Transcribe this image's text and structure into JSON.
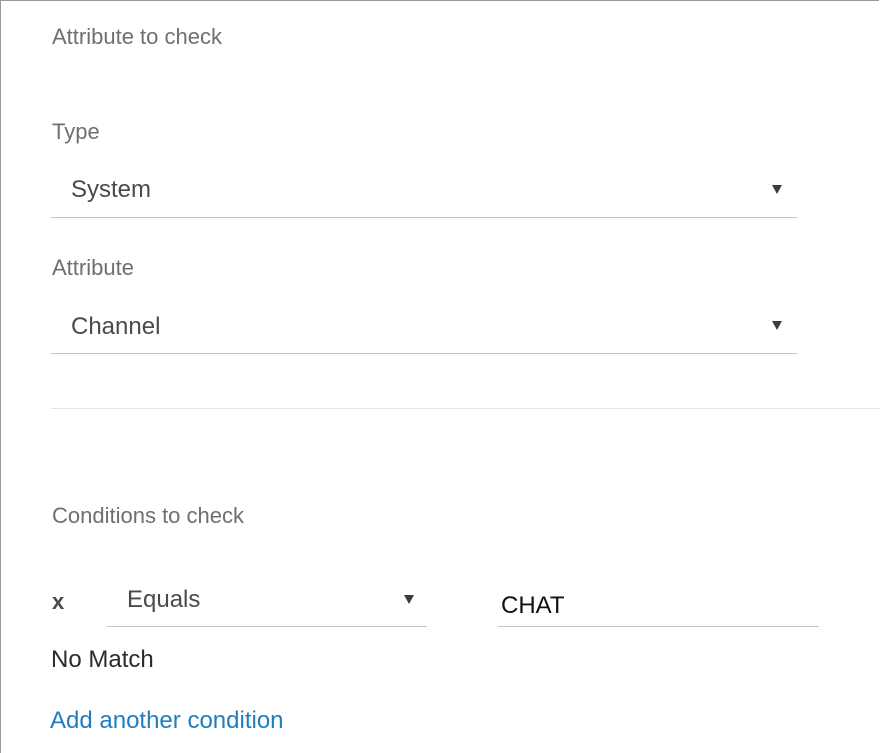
{
  "attribute_section": {
    "heading": "Attribute to check",
    "type_field": {
      "label": "Type",
      "selected": "System"
    },
    "attribute_field": {
      "label": "Attribute",
      "selected": "Channel"
    }
  },
  "conditions_section": {
    "heading": "Conditions to check",
    "conditions": [
      {
        "remove_label": "x",
        "operator": "Equals",
        "value": "CHAT"
      }
    ],
    "no_match_label": "No Match",
    "add_condition_label": "Add another condition"
  },
  "colors": {
    "link": "#1f7ec1",
    "label_gray": "#6f6f6f",
    "underline": "#c4c4c4"
  },
  "icons": {
    "dropdown": "caret-down-icon",
    "remove": "remove-icon"
  }
}
